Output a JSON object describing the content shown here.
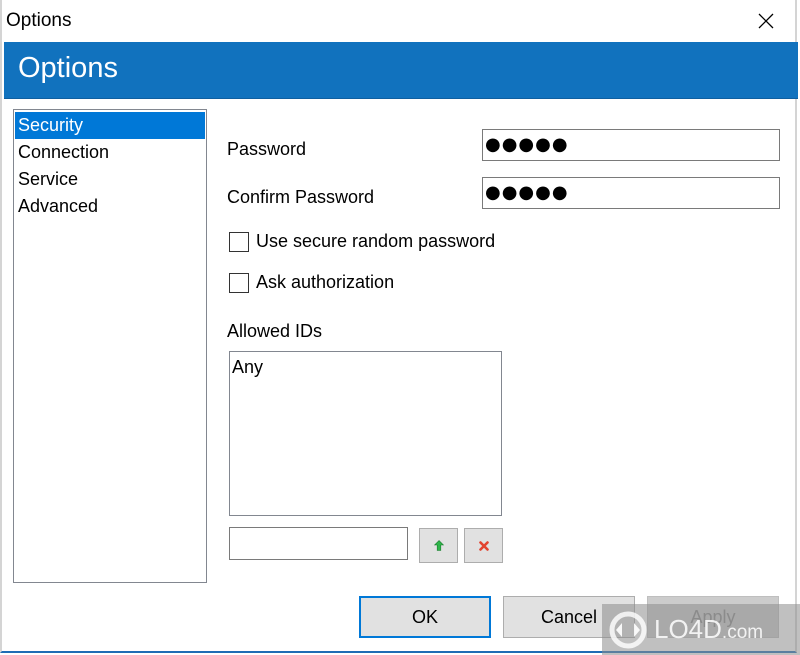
{
  "window": {
    "title": "Options",
    "close_label": "Close"
  },
  "banner": {
    "title": "Options",
    "color": "#1172be"
  },
  "sidebar": {
    "items": [
      {
        "label": "Security",
        "selected": true
      },
      {
        "label": "Connection",
        "selected": false
      },
      {
        "label": "Service",
        "selected": false
      },
      {
        "label": "Advanced",
        "selected": false
      }
    ]
  },
  "security": {
    "password_label": "Password",
    "password_value": "●●●●●",
    "confirm_label": "Confirm Password",
    "confirm_value": "●●●●●",
    "secure_random_label": "Use secure random password",
    "secure_random_checked": false,
    "ask_auth_label": "Ask authorization",
    "ask_auth_checked": false,
    "allowed_ids_label": "Allowed IDs",
    "allowed_ids": [
      "Any"
    ],
    "new_id_value": "",
    "add_icon": "green-up-arrow-icon",
    "remove_icon": "red-x-icon"
  },
  "buttons": {
    "ok": "OK",
    "cancel": "Cancel",
    "apply": "Apply"
  },
  "watermark": {
    "text": "LO4D",
    "suffix": ".com"
  }
}
